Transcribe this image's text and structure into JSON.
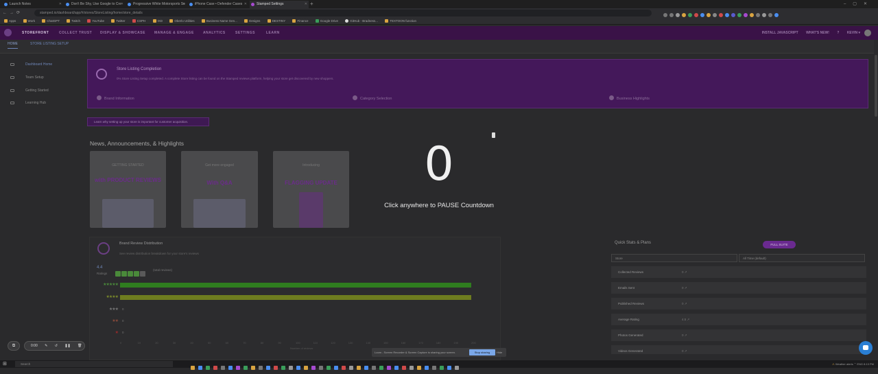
{
  "browser": {
    "tabs": [
      {
        "label": "Launch Notes",
        "active": false
      },
      {
        "label": "Don't Be Shy, Use Google to Cre",
        "active": false
      },
      {
        "label": "Progressive White Motorsports Se",
        "active": false
      },
      {
        "label": "iPhone Case • Defender Cases",
        "active": false
      },
      {
        "label": "Stamped Settings",
        "active": true
      }
    ],
    "url": "stamped.io/dashboard/app/#/stores/StoreListing/home/store_details",
    "bookmarks": [
      "Apps",
      "Work",
      "ChatGPT",
      "Twitch",
      "YouTube",
      "Twitter",
      "CSPH",
      "IXD",
      "Oberlo Utilities",
      "Business Name Gen...",
      "Designs",
      "DESTINY",
      "Finance",
      "Google Drive",
      "GitHub - Bradness...",
      "TEXTOON function"
    ]
  },
  "app": {
    "nav": [
      "STOREFRONT",
      "COLLECT TRUST",
      "DISPLAY & SHOWCASE",
      "MANAGE & ENGAGE",
      "ANALYTICS",
      "SETTINGS",
      "LEARN"
    ],
    "nav_right": [
      "INSTALL JAVASCRIPT",
      "WHAT'S NEW!"
    ],
    "user_short": "KEVIN ▾",
    "subtabs": [
      "HOME",
      "STORE LISTING SETUP"
    ],
    "sidebar": [
      "Dashboard Home",
      "Team Setup",
      "Getting Started",
      "Learning Hub"
    ]
  },
  "hero": {
    "title": "Store Listing Completion",
    "desc": "0% Store Listing Setup completed. A complete Store listing can be found on the Stamped reviews platform, helping your store get discovered by new shoppers.",
    "steps": [
      "Brand Information",
      "Category Selection",
      "Business Highlights"
    ],
    "learn_btn": "Learn why setting up your store is important for customer acquisition."
  },
  "news": {
    "title": "News, Announcements, & Highlights",
    "cards": [
      {
        "top": "GETTING STARTED",
        "main": "with PRODUCT REVIEWS"
      },
      {
        "top": "Get more engaged",
        "main": "With Q&A"
      },
      {
        "top": "Introducing",
        "main": "FLAGGING UPDATE"
      }
    ]
  },
  "overlay": {
    "countdown": "0",
    "hint": "Click anywhere to PAUSE Countdown"
  },
  "distribution": {
    "title": "Brand Review Distribution",
    "subtitle": "See review distribution breakdown for your store's reviews",
    "avg_rating": "4.4",
    "ratings_word": "Ratings",
    "star_count": "(total reviews)",
    "rows": [
      {
        "label": "★★★★★",
        "value": "0"
      },
      {
        "label": "★★★★",
        "value": "0"
      },
      {
        "label": "★★★",
        "value": "0"
      },
      {
        "label": "★★",
        "value": "0"
      },
      {
        "label": "★",
        "value": "0"
      }
    ],
    "axis_ticks": [
      "0",
      "10",
      "20",
      "30",
      "40",
      "50",
      "60",
      "70",
      "80",
      "90",
      "100",
      "110",
      "120",
      "130",
      "140",
      "150",
      "160",
      "170",
      "180",
      "190",
      "200"
    ],
    "axis_label": "Number of reviews"
  },
  "quickstats": {
    "title": "Quick Stats & Plans",
    "full_suite": "FULL SUITE",
    "select_a": "Store",
    "select_b": "All Time (default)",
    "rows": [
      {
        "k": "Collected Reviews",
        "v": "0 ↗"
      },
      {
        "k": "Emails Sent",
        "v": "0 ↗"
      },
      {
        "k": "Published Reviews",
        "v": "0 ↗"
      },
      {
        "k": "Average Rating",
        "v": "4.5 ↗"
      },
      {
        "k": "Photos Generated",
        "v": "0 ↗"
      },
      {
        "k": "Videos Generated",
        "v": "0 ↗"
      }
    ]
  },
  "video": {
    "time": "0:00",
    "cam_icon": "⧉"
  },
  "share_bar": {
    "text": "Loom - Screen Recorder & Screen Capture is sharing your screen.",
    "stop": "Stop sharing",
    "hide": "Hide"
  },
  "taskbar": {
    "search": "Search",
    "tray": "Weather alerts  ⌃  ENG  8:13 PM"
  }
}
